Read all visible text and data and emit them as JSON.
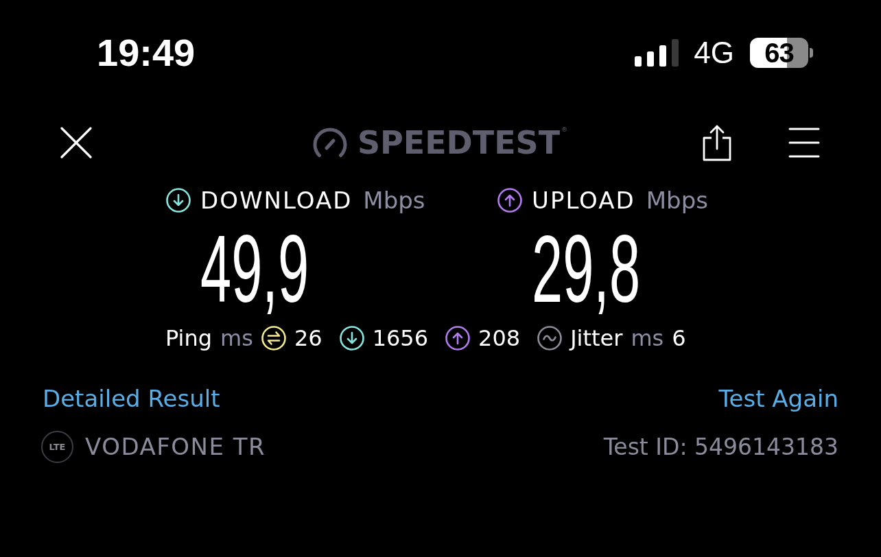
{
  "status_bar": {
    "time": "19:49",
    "network": "4G",
    "battery": "63"
  },
  "header": {
    "logo": "SPEEDTEST$^{®}$"
  },
  "results": [
    {
      "kind": "download",
      "label": "DOWNLOAD",
      "unit": "Mbps",
      "value": "49,9"
    },
    {
      "kind": "upload",
      "label": "UPLOAD",
      "unit": "Mbps",
      "value": "29,8"
    }
  ],
  "latency": [
    {
      "kind": "ping",
      "label": "Ping",
      "unit": "ms",
      "value": "26"
    },
    {
      "kind": "download",
      "value": "1656"
    },
    {
      "kind": "upload",
      "value": "208"
    },
    {
      "kind": "jitter",
      "label": "Jitter",
      "unit": "ms",
      "value": "6"
    }
  ],
  "links": {
    "detailed_result": "Detailed Result",
    "test_again": "Test Again"
  },
  "footer": {
    "network_badge": "LTE",
    "provider": "VODAFONE TR",
    "test_id": "Test ID: 5496143183"
  }
}
